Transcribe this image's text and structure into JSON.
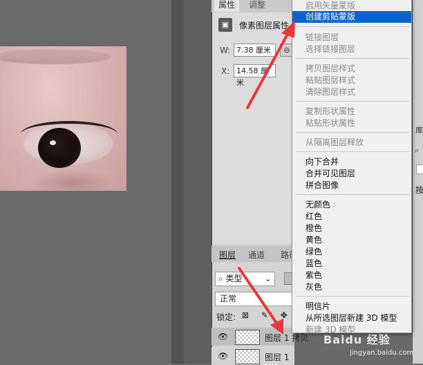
{
  "properties_panel": {
    "tabs": [
      "属性",
      "调整"
    ],
    "title": "像素图层属性",
    "w_label": "W:",
    "w_value": "7.38 厘米",
    "link_icon": "link-icon",
    "x_label": "X:",
    "x_value": "14.58 厘米"
  },
  "layers_panel": {
    "tabs": [
      "图层",
      "通道",
      "路径"
    ],
    "filter_label": "类型",
    "blend_mode": "正常",
    "lock_label": "锁定:",
    "lock_icons": "⊠ ✎ ✥",
    "layers": [
      {
        "name": "图层 1 拷贝",
        "visible": true,
        "selected": true
      },
      {
        "name": "图层 1",
        "visible": true,
        "selected": false
      }
    ]
  },
  "right_panel": {
    "tab_label": "库",
    "label": "按"
  },
  "context_menu": {
    "items": [
      {
        "label": "启用矢量蒙版",
        "disabled": true
      },
      {
        "label": "创建剪贴蒙版",
        "highlighted": true
      },
      {
        "label": "链接图层",
        "disabled": true
      },
      {
        "label": "选择链接图层",
        "disabled": true
      },
      {
        "label": "拷贝图层样式",
        "disabled": true
      },
      {
        "label": "粘贴图层样式",
        "disabled": true
      },
      {
        "label": "清除图层样式",
        "disabled": true
      },
      {
        "label": "复制形状属性",
        "disabled": true
      },
      {
        "label": "粘贴形状属性",
        "disabled": true
      },
      {
        "label": "从隔离图层释放",
        "disabled": true
      },
      {
        "label": "向下合并"
      },
      {
        "label": "合并可见图层"
      },
      {
        "label": "拼合图像"
      },
      {
        "label": "无颜色"
      },
      {
        "label": "红色"
      },
      {
        "label": "橙色"
      },
      {
        "label": "黄色"
      },
      {
        "label": "绿色"
      },
      {
        "label": "蓝色"
      },
      {
        "label": "紫色"
      },
      {
        "label": "灰色"
      },
      {
        "label": "明信片"
      },
      {
        "label": "从所选图层新建 3D 模型"
      },
      {
        "label": "新建 3D 模型",
        "disabled": true
      }
    ],
    "highlight_color": "#0a64d0"
  },
  "annotations": {
    "arrow_color": "#e8363a"
  },
  "watermark": {
    "text": "Baidu 经验",
    "url": "jingyan.baidu.com"
  }
}
